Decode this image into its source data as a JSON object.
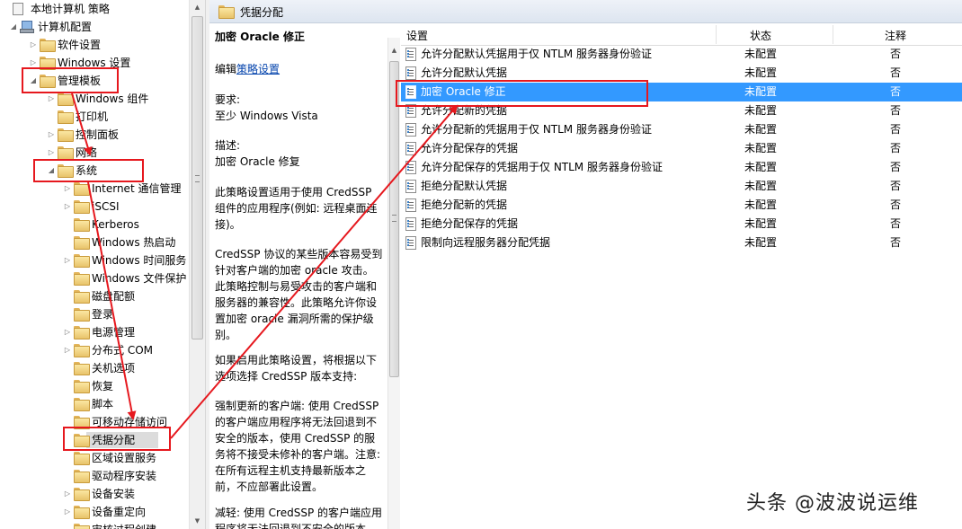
{
  "tree": {
    "items": [
      {
        "label": "本地计算机 策略",
        "level": 0,
        "toggle": "",
        "icon": "computer-icon"
      },
      {
        "label": "计算机配置",
        "level": 1,
        "toggle": "◢",
        "icon": "computer-icon"
      },
      {
        "label": "软件设置",
        "level": 2,
        "toggle": "▷",
        "icon": "folder-icon"
      },
      {
        "label": "Windows 设置",
        "level": 2,
        "toggle": "▷",
        "icon": "folder-icon"
      },
      {
        "label": "管理模板",
        "level": 2,
        "toggle": "◢",
        "icon": "folder-icon"
      },
      {
        "label": "Windows 组件",
        "level": 3,
        "toggle": "▷",
        "icon": "folder-icon"
      },
      {
        "label": "打印机",
        "level": 3,
        "toggle": "",
        "icon": "folder-icon"
      },
      {
        "label": "控制面板",
        "level": 3,
        "toggle": "▷",
        "icon": "folder-icon"
      },
      {
        "label": "网络",
        "level": 3,
        "toggle": "▷",
        "icon": "folder-icon"
      },
      {
        "label": "系统",
        "level": 3,
        "toggle": "◢",
        "icon": "folder-icon"
      },
      {
        "label": "Internet 通信管理",
        "level": 4,
        "toggle": "▷",
        "icon": "folder-icon"
      },
      {
        "label": "iSCSI",
        "level": 4,
        "toggle": "▷",
        "icon": "folder-icon"
      },
      {
        "label": "Kerberos",
        "level": 4,
        "toggle": "",
        "icon": "folder-icon"
      },
      {
        "label": "Windows 热启动",
        "level": 4,
        "toggle": "",
        "icon": "folder-icon"
      },
      {
        "label": "Windows 时间服务",
        "level": 4,
        "toggle": "▷",
        "icon": "folder-icon"
      },
      {
        "label": "Windows 文件保护",
        "level": 4,
        "toggle": "",
        "icon": "folder-icon"
      },
      {
        "label": "磁盘配额",
        "level": 4,
        "toggle": "",
        "icon": "folder-icon"
      },
      {
        "label": "登录",
        "level": 4,
        "toggle": "",
        "icon": "folder-icon"
      },
      {
        "label": "电源管理",
        "level": 4,
        "toggle": "▷",
        "icon": "folder-icon"
      },
      {
        "label": "分布式 COM",
        "level": 4,
        "toggle": "▷",
        "icon": "folder-icon"
      },
      {
        "label": "关机选项",
        "level": 4,
        "toggle": "",
        "icon": "folder-icon"
      },
      {
        "label": "恢复",
        "level": 4,
        "toggle": "",
        "icon": "folder-icon"
      },
      {
        "label": "脚本",
        "level": 4,
        "toggle": "",
        "icon": "folder-icon"
      },
      {
        "label": "可移动存储访问",
        "level": 4,
        "toggle": "",
        "icon": "folder-icon"
      },
      {
        "label": "凭据分配",
        "level": 4,
        "toggle": "",
        "icon": "folder-icon",
        "selected": true
      },
      {
        "label": "区域设置服务",
        "level": 4,
        "toggle": "",
        "icon": "folder-icon"
      },
      {
        "label": "驱动程序安装",
        "level": 4,
        "toggle": "",
        "icon": "folder-icon"
      },
      {
        "label": "设备安装",
        "level": 4,
        "toggle": "▷",
        "icon": "folder-icon"
      },
      {
        "label": "设备重定向",
        "level": 4,
        "toggle": "▷",
        "icon": "folder-icon"
      },
      {
        "label": "审核过程创建",
        "level": 4,
        "toggle": "",
        "icon": "folder-icon"
      }
    ]
  },
  "header": {
    "title": "凭据分配"
  },
  "description": {
    "title": "加密 Oracle 修正",
    "edit_prefix": "编辑",
    "edit_link": "策略设置",
    "requirements_label": "要求:",
    "requirements_value": "至少 Windows Vista",
    "description_label": "描述:",
    "description_value": "加密 Oracle 修复",
    "para1": "此策略设置适用于使用 CredSSP 组件的应用程序(例如: 远程桌面连接)。",
    "para2": "CredSSP 协议的某些版本容易受到针对客户端的加密 oracle 攻击。此策略控制与易受攻击的客户端和服务器的兼容性。此策略允许你设置加密 oracle 漏洞所需的保护级别。",
    "para3": "如果启用此策略设置，将根据以下选项选择 CredSSP 版本支持:",
    "para4": "强制更新的客户端: 使用 CredSSP 的客户端应用程序将无法回退到不安全的版本，使用 CredSSP 的服务将不接受未修补的客户端。注意: 在所有远程主机支持最新版本之前，不应部署此设置。",
    "para5": "减轻: 使用 CredSSP 的客户端应用程序将无法回退到不安全的版本"
  },
  "list": {
    "headers": {
      "setting": "设置",
      "state": "状态",
      "comment": "注释"
    },
    "rows": [
      {
        "setting": "允许分配默认凭据用于仅 NTLM 服务器身份验证",
        "state": "未配置",
        "comment": "否"
      },
      {
        "setting": "允许分配默认凭据",
        "state": "未配置",
        "comment": "否"
      },
      {
        "setting": "加密 Oracle 修正",
        "state": "未配置",
        "comment": "否",
        "selected": true
      },
      {
        "setting": "允许分配新的凭据",
        "state": "未配置",
        "comment": "否"
      },
      {
        "setting": "允许分配新的凭据用于仅 NTLM 服务器身份验证",
        "state": "未配置",
        "comment": "否"
      },
      {
        "setting": "允许分配保存的凭据",
        "state": "未配置",
        "comment": "否"
      },
      {
        "setting": "允许分配保存的凭据用于仅 NTLM 服务器身份验证",
        "state": "未配置",
        "comment": "否"
      },
      {
        "setting": "拒绝分配默认凭据",
        "state": "未配置",
        "comment": "否"
      },
      {
        "setting": "拒绝分配新的凭据",
        "state": "未配置",
        "comment": "否"
      },
      {
        "setting": "拒绝分配保存的凭据",
        "state": "未配置",
        "comment": "否"
      },
      {
        "setting": "限制向远程服务器分配凭据",
        "state": "未配置",
        "comment": "否"
      }
    ]
  },
  "annotation": {
    "color": "#e6181e"
  },
  "watermark": "头条 @波波说运维"
}
